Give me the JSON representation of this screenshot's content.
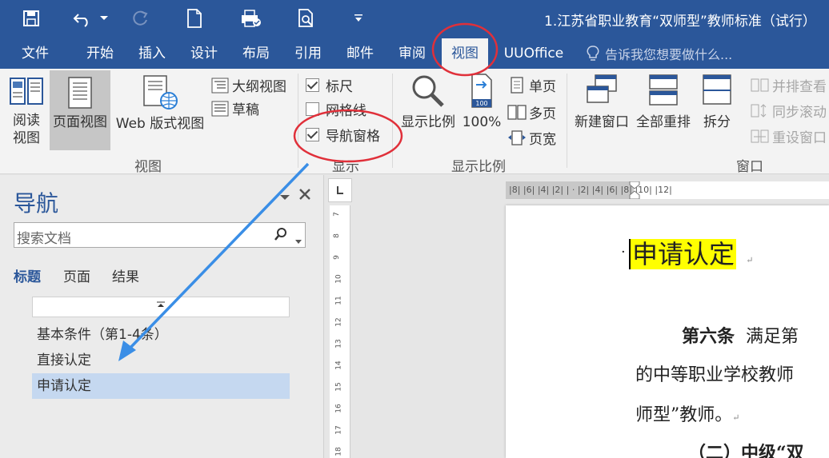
{
  "window": {
    "title": "1.江苏省职业教育“双师型”教师标准（试行）"
  },
  "tabs": [
    "文件",
    "开始",
    "插入",
    "设计",
    "布局",
    "引用",
    "邮件",
    "审阅",
    "视图",
    "UUOffice"
  ],
  "tell_me": "告诉我您想要做什么...",
  "ribbon": {
    "view_group": {
      "label": "视图",
      "read_mode": "阅读\n视图",
      "print_layout": "页面视图",
      "web_layout": "Web 版式视图",
      "outline": "大纲视图",
      "draft": "草稿"
    },
    "show_group": {
      "label": "显示",
      "ruler": "标尺",
      "gridlines": "网格线",
      "nav_pane": "导航窗格",
      "ruler_checked": true,
      "gridlines_checked": false,
      "nav_pane_checked": true
    },
    "zoom_group": {
      "label": "显示比例",
      "zoom": "显示比例",
      "hundred": "100%",
      "one_page": "单页",
      "multi_page": "多页",
      "page_width": "页宽"
    },
    "window_group": {
      "label": "窗口",
      "new_window": "新建窗口",
      "arrange_all": "全部重排",
      "split": "拆分",
      "side_by_side": "并排查看",
      "sync_scroll": "同步滚动",
      "reset_window": "重设窗口"
    }
  },
  "nav": {
    "title": "导航",
    "search_placeholder": "搜索文档",
    "tabs": [
      "标题",
      "页面",
      "结果"
    ],
    "headings": [
      "基本条件（第1-4条）",
      "直接认定",
      "申请认定"
    ]
  },
  "ruler": {
    "h_ticks": "|8| |6| |4| |2| |  · |2| |4| |6| |8| |10| |12|",
    "v_ticks": [
      "7",
      "8",
      "9",
      "10",
      "11",
      "12",
      "13",
      "14",
      "15",
      "16",
      "17",
      "18"
    ]
  },
  "document": {
    "heading": "申请认定",
    "para_lead": "第六条",
    "para1": "满足第",
    "para2": "的中等职业学校教师",
    "para3": "师型”教师。",
    "para4": "（二）中级“双"
  },
  "colors": {
    "accent": "#2b579a",
    "highlight": "#ffff00",
    "annotation": "#e0303a",
    "arrow": "#3a8ee6"
  }
}
